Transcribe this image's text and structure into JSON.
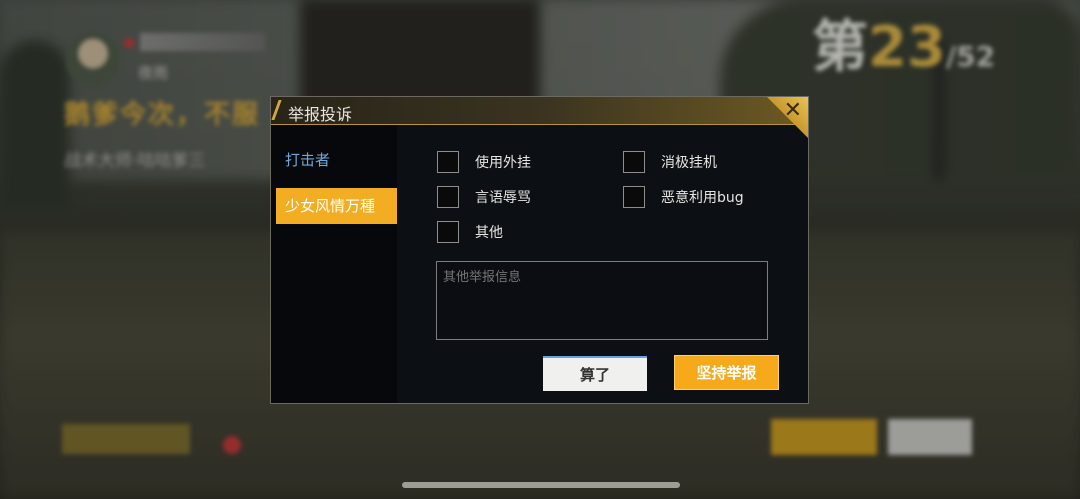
{
  "background_hud": {
    "player_tag": "夜雨",
    "kill_banner": "鹅爹今次，不服",
    "kill_line": "战术大师·咕咕爹三",
    "rank_prefix": "第",
    "rank_number": "23",
    "rank_total": "/52"
  },
  "dialog": {
    "title": "举报投诉",
    "close_icon": "close-icon",
    "sidebar": [
      {
        "label": "打击者"
      },
      {
        "label": "少女风情万種"
      }
    ],
    "options": [
      {
        "label": "使用外挂",
        "checked": false
      },
      {
        "label": "消极挂机",
        "checked": false
      },
      {
        "label": "言语辱骂",
        "checked": false
      },
      {
        "label": "恶意利用bug",
        "checked": false
      },
      {
        "label": "其他",
        "checked": false
      }
    ],
    "textarea_placeholder": "其他举报信息",
    "cancel_label": "算了",
    "report_label": "坚持举报"
  },
  "colors": {
    "accent": "#f3ad22",
    "dialog_bg": "#0c0f14",
    "link_blue": "#6fa7d8"
  }
}
